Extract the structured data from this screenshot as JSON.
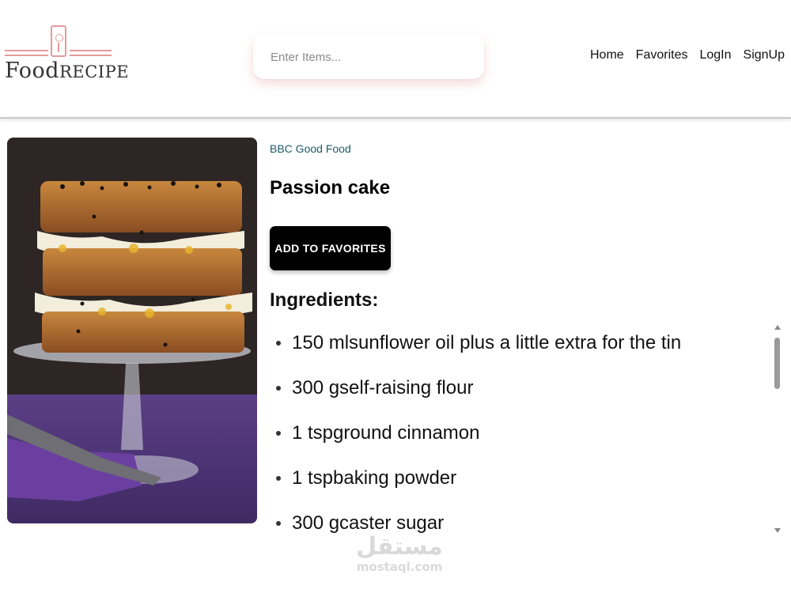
{
  "header": {
    "logo_text_main": "Food",
    "logo_text_rest": "Recipe",
    "search_placeholder": "Enter Items...",
    "nav": [
      {
        "label": "Home"
      },
      {
        "label": "Favorites"
      },
      {
        "label": "LogIn"
      },
      {
        "label": "SignUp"
      }
    ]
  },
  "recipe": {
    "source": "BBC Good Food",
    "title": "Passion cake",
    "favorite_button": "ADD TO FAVORITES",
    "ingredients_heading": "Ingredients:",
    "ingredients": [
      {
        "text": "150 mlsunflower oil plus a little extra for the tin"
      },
      {
        "text": "300 gself-raising flour"
      },
      {
        "text": "1 tspground cinnamon"
      },
      {
        "text": "1 tspbaking powder"
      },
      {
        "text": "300 gcaster sugar"
      }
    ]
  },
  "watermark": {
    "arabic": "مستقل",
    "latin": "mostaql.com"
  },
  "colors": {
    "accent": "#e79a9a",
    "source_link": "#1e5a6a",
    "button_bg": "#000000"
  }
}
